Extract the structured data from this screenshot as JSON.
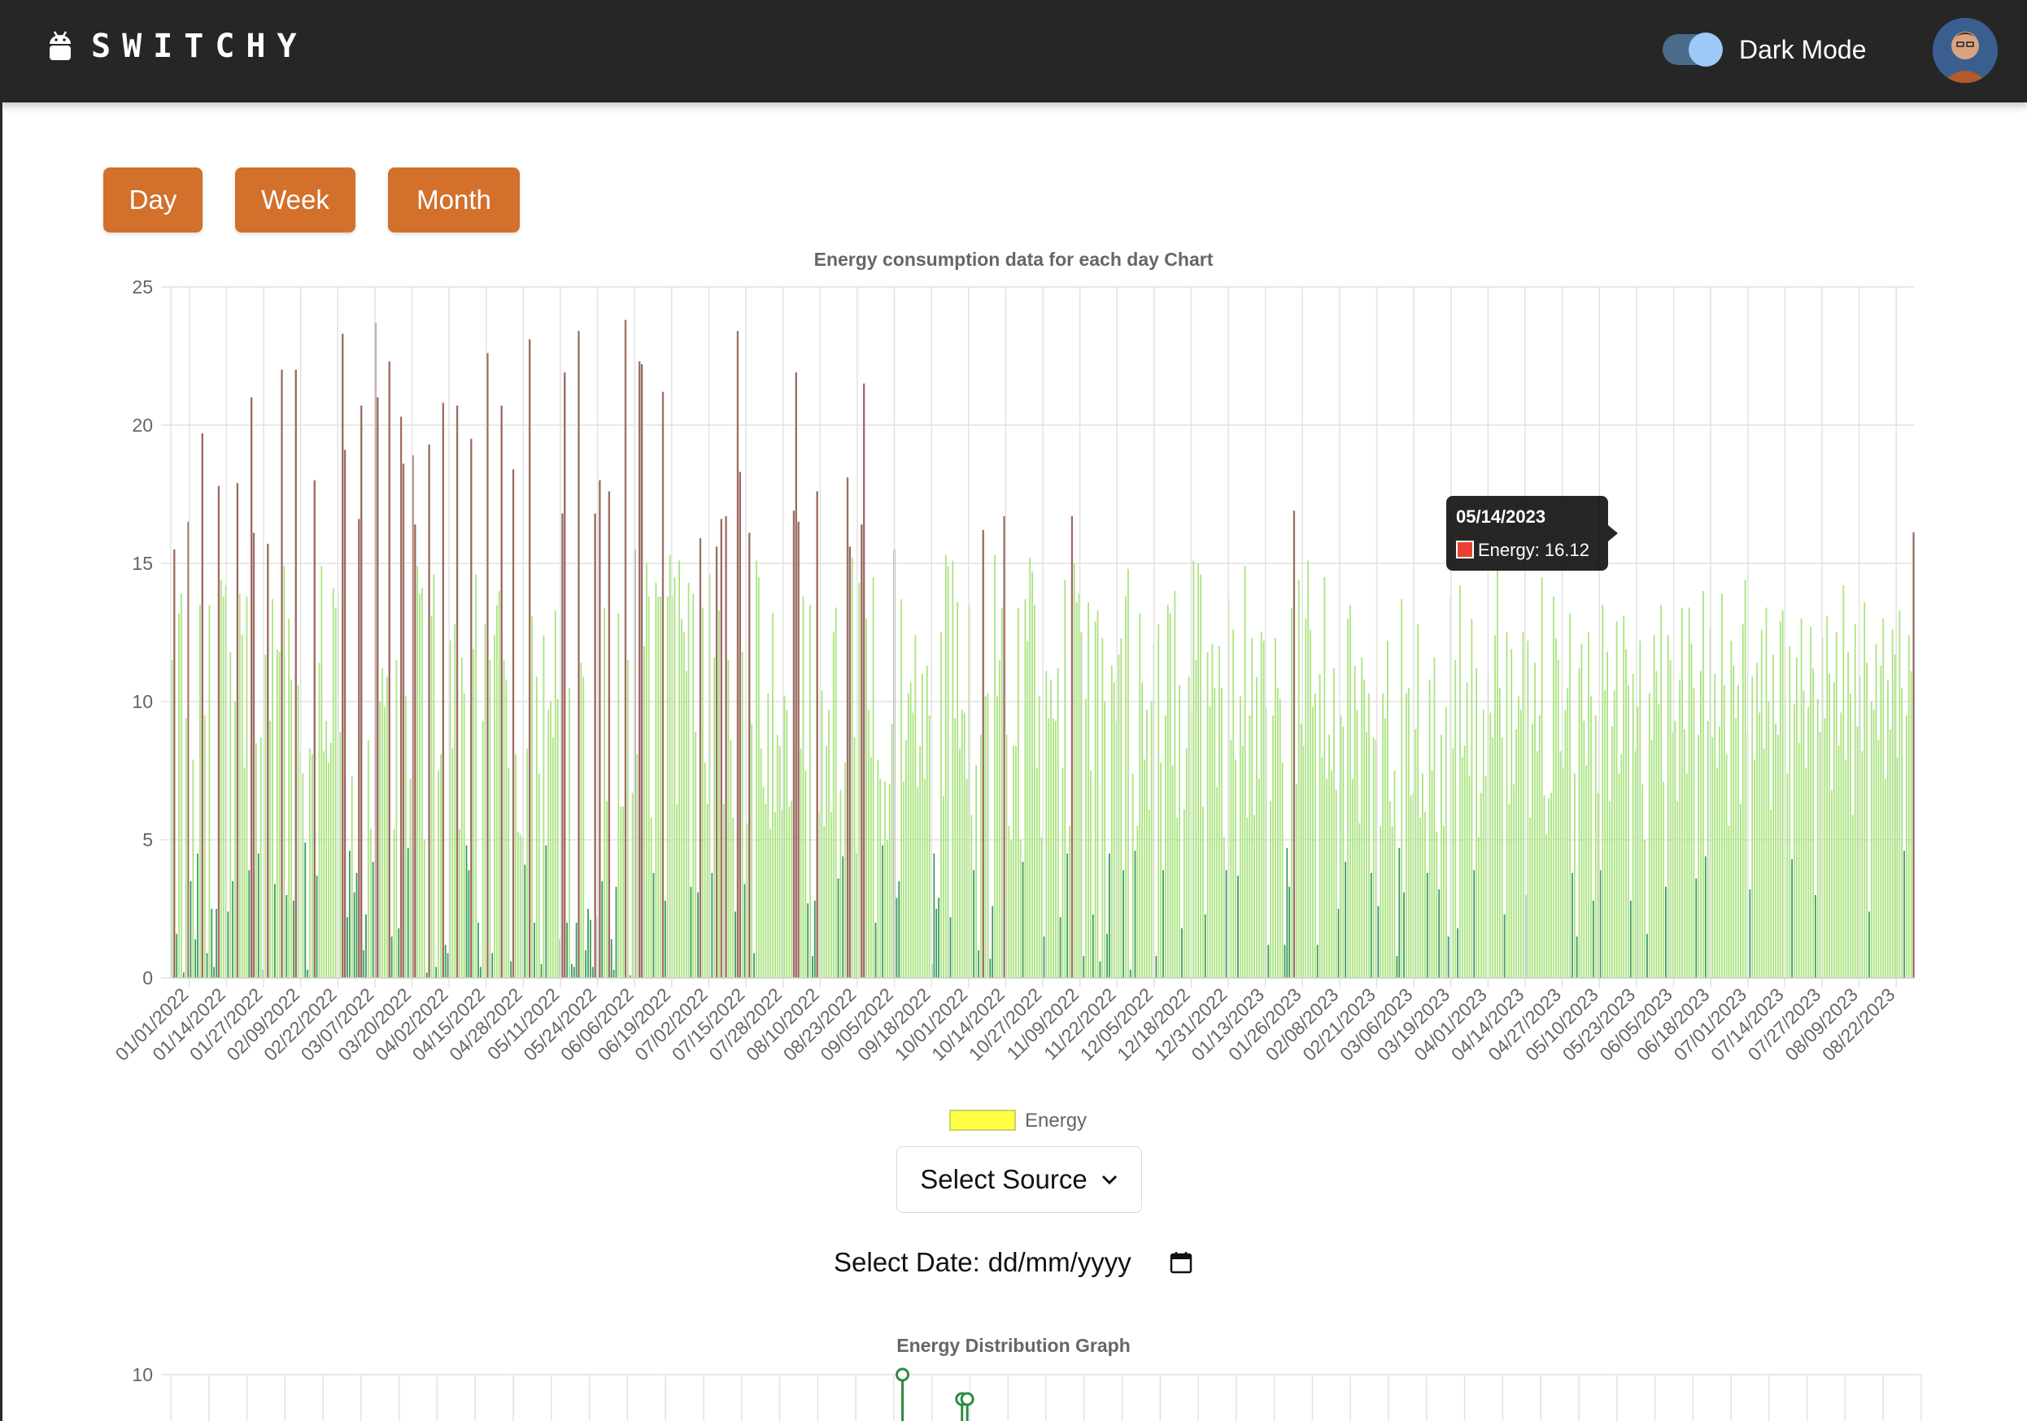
{
  "app": {
    "brand": "SWITCHY",
    "dark_mode_label": "Dark Mode",
    "dark_mode_on": true
  },
  "buttons": {
    "day": "Day",
    "week": "Week",
    "month": "Month"
  },
  "controls": {
    "select_source": "Select Source",
    "date_label": "Select Date:",
    "date_placeholder": "dd/mm/yyyy"
  },
  "colors": {
    "accent": "#d2702c",
    "topbar": "#262626",
    "bar_green": "#a9e37f",
    "bar_dark_green": "#3a9a5c",
    "bar_red": "#b5553f",
    "legend_fill": "#ffff44"
  },
  "chart_data": {
    "type": "bar",
    "title": "Energy consumption data for each day Chart",
    "ylim": [
      0,
      25
    ],
    "yticks": [
      0,
      5,
      10,
      15,
      20,
      25
    ],
    "x_tick_labels": [
      "01/01/2022",
      "01/14/2022",
      "01/27/2022",
      "02/09/2022",
      "02/22/2022",
      "03/07/2022",
      "03/20/2022",
      "04/02/2022",
      "04/15/2022",
      "04/28/2022",
      "05/11/2022",
      "05/24/2022",
      "06/06/2022",
      "06/19/2022",
      "07/02/2022",
      "07/15/2022",
      "07/28/2022",
      "08/10/2022",
      "08/23/2022",
      "09/05/2022",
      "09/18/2022",
      "10/01/2022",
      "10/14/2022",
      "10/27/2022",
      "11/09/2022",
      "11/22/2022",
      "12/05/2022",
      "12/18/2022",
      "12/31/2022",
      "01/13/2023",
      "01/26/2023",
      "02/08/2023",
      "02/21/2023",
      "03/06/2023",
      "03/19/2023",
      "04/01/2023",
      "04/14/2023",
      "04/27/2023",
      "05/10/2023",
      "05/23/2023",
      "06/05/2023",
      "06/18/2023",
      "07/01/2023",
      "07/14/2023",
      "07/27/2023",
      "08/09/2023",
      "08/22/2023"
    ],
    "legend": [
      "Energy"
    ],
    "grid": true,
    "tooltip": {
      "date": "05/14/2023",
      "label": "Energy: 16.12",
      "value": 16.12
    },
    "series": [
      {
        "name": "Energy",
        "values": [
          11.5,
          15.5,
          1.6,
          13.2,
          13.9,
          0.2,
          9.4,
          16.5,
          3.5,
          7.9,
          1.4,
          4.5,
          13.5,
          19.7,
          9.5,
          0.9,
          13.5,
          2.5,
          0.4,
          2.5,
          17.8,
          14.4,
          13.8,
          14.2,
          2.4,
          11.8,
          3.5,
          10.0,
          17.9,
          13.9,
          12.4,
          7.6,
          13.8,
          3.9,
          21.0,
          16.1,
          8.5,
          4.5,
          8.7,
          0.3,
          11.7,
          15.7,
          9.3,
          13.7,
          3.4,
          11.9,
          11.8,
          22.0,
          14.9,
          3.0,
          13.0,
          10.8,
          2.8,
          22.0,
          10.6,
          8.2,
          7.4,
          4.9,
          0.3,
          8.3,
          8.1,
          18.0,
          3.7,
          11.4,
          14.9,
          8.2,
          9.3,
          7.8,
          8.5,
          14.1,
          13.4,
          14.0,
          8.9,
          23.3,
          19.1,
          2.2,
          4.6,
          7.3,
          3.1,
          3.8,
          16.6,
          20.7,
          1.0,
          2.3,
          8.6,
          5.4,
          4.2,
          23.7,
          21.0,
          10.0,
          11.2,
          9.8,
          10.9,
          22.3,
          1.5,
          5.4,
          11.5,
          1.8,
          20.3,
          18.6,
          10.2,
          4.7,
          7.2,
          18.9,
          16.4,
          14.9,
          13.9,
          14.1,
          5.0,
          0.2,
          19.3,
          13.1,
          14.6,
          0.4,
          7.5,
          8.1,
          20.8,
          1.2,
          0.9,
          12.2,
          8.3,
          12.8,
          20.7,
          5.4,
          11.6,
          10.3,
          4.8,
          3.9,
          19.5,
          11.9,
          14.6,
          2.0,
          0.4,
          9.3,
          12.8,
          22.6,
          11.5,
          0.9,
          12.4,
          13.5,
          14.0,
          20.7,
          11.5,
          10.8,
          7.6,
          0.6,
          18.4,
          8.1,
          5.3,
          5.2,
          5.1,
          4.1,
          8.3,
          23.1,
          13.1,
          2.0,
          10.9,
          7.4,
          0.5,
          12.4,
          4.8,
          9.7,
          10.0,
          8.7,
          13.3,
          10.1,
          1.4,
          16.8,
          21.9,
          2.0,
          10.5,
          0.5,
          0.4,
          2.0,
          23.4,
          11.4,
          10.9,
          1.0,
          2.5,
          2.1,
          0.4,
          16.8,
          2.2,
          18.0,
          3.5,
          13.4,
          6.4,
          17.6,
          1.4,
          0.3,
          3.3,
          13.2,
          6.2,
          6.2,
          23.8,
          11.5,
          0.1,
          6.7,
          15.5,
          8.1,
          22.3,
          22.2,
          12.0,
          15.0,
          13.8,
          5.8,
          3.8,
          14.3,
          13.8,
          13.8,
          21.2,
          2.8,
          13.8,
          15.3,
          13.8,
          14.5,
          6.3,
          15.1,
          13.0,
          12.5,
          11.1,
          14.3,
          3.3,
          13.9,
          8.9,
          3.1,
          15.9,
          13.4,
          7.8,
          6.3,
          14.6,
          3.8,
          11.6,
          15.6,
          13.3,
          16.6,
          6.3,
          16.7,
          11.5,
          8.6,
          5.8,
          2.4,
          23.4,
          18.3,
          11.8,
          3.4,
          5.6,
          16.1,
          9.2,
          0.9,
          15.1,
          14.5,
          8.3,
          6.9,
          6.3,
          10.3,
          5.4,
          13.2,
          6.0,
          8.8,
          8.4,
          6.1,
          10.2,
          9.7,
          6.2,
          6.4,
          16.9,
          21.9,
          16.5,
          8.3,
          13.8,
          7.5,
          2.7,
          13.5,
          0.8,
          2.8,
          17.6,
          6.0,
          10.4,
          5.5,
          8.4,
          9.7,
          6.0,
          12.5,
          13.4,
          3.6,
          6.8,
          4.4,
          7.8,
          18.1,
          15.6,
          15.2,
          8.7,
          4.5,
          14.3,
          16.4,
          21.5,
          13.0,
          9.7,
          8.0,
          14.5,
          2.0,
          7.9,
          7.2,
          4.8,
          7.1,
          5.0,
          7.0,
          9.2,
          15.5,
          2.9,
          3.5,
          13.7,
          7.1,
          8.6,
          10.3,
          10.7,
          9.6,
          12.4,
          6.9,
          8.4,
          11.0,
          7.2,
          11.3,
          9.5,
          0.5,
          4.5,
          2.5,
          2.9,
          12.5,
          6.6,
          15.3,
          14.9,
          2.2,
          15.1,
          9.4,
          13.6,
          8.3,
          9.7,
          9.6,
          7.2,
          13.5,
          5.9,
          3.9,
          7.7,
          1.0,
          8.8,
          16.2,
          10.2,
          10.3,
          0.7,
          2.6,
          15.3,
          10.2,
          11.5,
          13.4,
          16.7,
          8.8,
          5.5,
          5.0,
          8.4,
          8.4,
          13.4,
          5.0,
          4.2,
          13.7,
          12.2,
          15.2,
          14.7,
          13.5,
          7.6,
          10.2,
          5.1,
          1.5,
          11.1,
          9.4,
          10.8,
          9.4,
          9.3,
          11.2,
          2.2,
          7.6,
          14.4,
          4.5,
          5.5,
          16.7,
          15.0,
          13.6,
          13.9,
          12.5,
          0.8,
          10.1,
          13.6,
          7.5,
          2.3,
          12.9,
          13.3,
          0.6,
          12.3,
          10.0,
          1.6,
          4.5,
          11.3,
          10.7,
          9.3,
          11.7,
          12.3,
          3.9,
          13.8,
          14.8,
          0.3,
          7.4,
          4.6,
          5.5,
          13.2,
          10.7,
          7.9,
          9.7,
          6.1,
          10.0,
          12.1,
          0.8,
          12.8,
          7.8,
          3.9,
          9.5,
          13.5,
          13.2,
          7.7,
          14.0,
          5.8,
          10.6,
          1.8,
          6.1,
          8.3,
          10.9,
          9.7,
          15.1,
          11.5,
          15.0,
          14.6,
          6.2,
          2.3,
          11.8,
          9.8,
          12.1,
          10.5,
          6.9,
          12.0,
          10.5,
          5.1,
          3.9,
          13.7,
          8.6,
          12.6,
          7.9,
          3.7,
          10.2,
          8.4,
          14.9,
          5.8,
          9.5,
          12.3,
          5.9,
          10.9,
          7.2,
          12.5,
          12.2,
          9.8,
          1.2,
          6.4,
          9.5,
          12.3,
          10.5,
          10.1,
          7.8,
          1.2,
          4.7,
          3.3,
          13.4,
          16.9,
          7.0,
          14.4,
          9.2,
          8.4,
          13.0,
          15.1,
          12.6,
          9.8,
          10.3,
          1.2,
          11.0,
          8.0,
          14.5,
          7.2,
          8.8,
          7.5,
          11.2,
          6.8,
          2.5,
          9.5,
          9.1,
          4.2,
          13.0,
          13.5,
          7.2,
          11.3,
          9.7,
          5.6,
          11.6,
          10.8,
          8.9,
          10.3,
          3.8,
          8.7,
          8.6,
          2.6,
          5.5,
          10.3,
          9.4,
          12.2,
          6.4,
          5.5,
          7.5,
          0.8,
          4.7,
          13.7,
          3.1,
          10.3,
          10.5,
          6.6,
          6.7,
          9.0,
          12.8,
          5.8,
          7.4,
          6.0,
          3.8,
          10.8,
          7.5,
          11.6,
          5.3,
          3.2,
          8.8,
          5.5,
          9.8,
          1.5,
          13.8,
          8.3,
          11.5,
          1.8,
          14.2,
          8.0,
          8.4,
          10.7,
          7.3,
          13.0,
          3.9,
          11.2,
          5.1,
          6.7,
          9.7,
          7.3,
          11.0,
          9.6,
          8.7,
          12.4,
          14.8,
          10.5,
          8.7,
          2.3,
          12.5,
          6.3,
          11.9,
          7.0,
          9.0,
          10.2,
          9.7,
          12.5,
          3.0,
          12.2,
          5.8,
          9.2,
          11.4,
          8.2,
          9.5,
          14.5,
          6.6,
          5.2,
          6.5,
          6.7,
          13.8,
          12.3,
          11.5,
          8.2,
          7.6,
          9.7,
          10.5,
          13.2,
          3.8,
          7.4,
          1.5,
          11.2,
          12.1,
          9.3,
          7.7,
          12.5,
          10.2,
          2.8,
          9.5,
          6.7,
          3.9,
          13.5,
          10.4,
          11.8,
          6.4,
          9.1,
          10.4,
          12.9,
          7.4,
          8.1,
          13.1,
          11.9,
          10.6,
          2.8,
          11.0,
          8.2,
          9.8,
          12.2,
          7.0,
          5.0,
          1.6,
          10.3,
          8.6,
          12.4,
          11.1,
          9.9,
          13.5,
          7.1,
          3.3,
          12.4,
          11.5,
          8.9,
          9.3,
          6.4,
          10.8,
          13.4,
          9.0,
          7.4,
          13.4,
          12.1,
          10.5,
          3.6,
          8.8,
          11.1,
          14.0,
          4.4,
          9.3,
          12.7,
          8.7,
          11.0,
          7.6,
          9.1,
          13.9,
          10.6,
          8.1,
          5.5,
          12.2,
          11.3,
          9.4,
          10.6,
          6.3,
          12.8,
          14.4,
          8.9,
          3.2,
          10.9,
          7.9,
          11.4,
          9.6,
          12.6,
          8.3,
          13.4,
          10.0,
          6.1,
          11.7,
          9.2,
          8.8,
          12.9,
          13.3,
          10.2,
          7.4,
          12.0,
          4.3,
          9.9,
          11.6,
          8.5,
          13.0,
          10.4,
          7.6,
          9.8,
          12.7,
          11.2,
          3.0,
          10.1,
          8.9,
          12.3,
          9.4,
          13.1,
          11.0,
          6.8,
          10.7,
          12.5,
          8.4,
          9.6,
          14.2,
          7.9,
          11.8,
          10.3,
          5.9,
          12.8,
          9.1,
          10.9,
          8.2,
          13.6,
          11.4,
          2.4,
          10.0,
          9.7,
          12.1,
          8.6,
          11.3,
          13.0,
          7.2,
          10.8,
          9.0,
          12.6,
          11.7,
          8.0,
          13.3,
          10.5,
          4.6,
          9.5,
          12.4,
          11.1,
          16.12
        ]
      }
    ]
  },
  "distribution_chart": {
    "title": "Energy Distribution Graph",
    "ytick_top": 10,
    "points": [
      {
        "x": 0.418,
        "y": 10.0
      },
      {
        "x": 0.452,
        "y": 9.7
      },
      {
        "x": 0.455,
        "y": 9.7
      }
    ]
  }
}
